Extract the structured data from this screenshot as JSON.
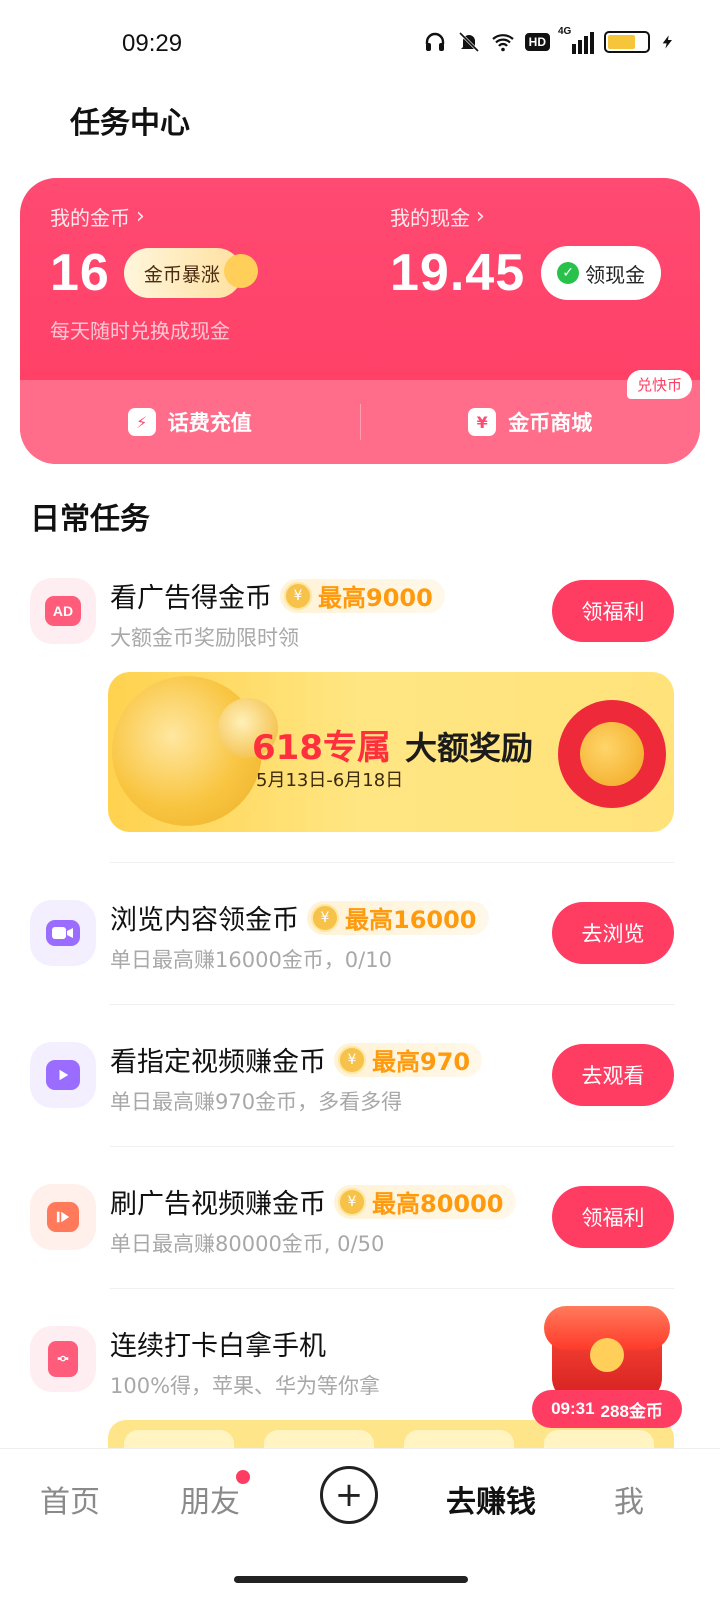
{
  "status_bar": {
    "time": "09:29",
    "network_label": "HD",
    "cell_label": "4G",
    "icons": [
      "headphones-icon",
      "mute-icon",
      "wifi-icon",
      "hd-icon",
      "signal-icon",
      "battery-icon",
      "charging-icon"
    ],
    "battery_level": 0.7
  },
  "header": {
    "title": "任务中心"
  },
  "wallet": {
    "coins_label": "我的金币",
    "coins_value": "16",
    "boom_label": "金币暴涨",
    "coins_sub": "每天随时兑换成现金",
    "cash_label": "我的现金",
    "cash_value": "19.45",
    "withdraw_label": "领现金",
    "recharge_label": "话费充值",
    "mall_label": "金币商城",
    "mall_badge": "兑快币",
    "accent": "#ff3d63"
  },
  "daily": {
    "title": "日常任务",
    "tasks": [
      {
        "title": "看广告得金币",
        "reward": "最高9000",
        "sub": "大额金币奖励限时领",
        "button": "领福利",
        "icon": "ad-icon",
        "icon_text": "AD"
      },
      {
        "title": "浏览内容领金币",
        "reward": "最高16000",
        "sub": "单日最高赚16000金币，0/10",
        "button": "去浏览",
        "icon": "video-camera-icon"
      },
      {
        "title": "看指定视频赚金币",
        "reward": "最高970",
        "sub": "单日最高赚970金币，多看多得",
        "button": "去观看",
        "icon": "play-icon"
      },
      {
        "title": "刷广告视频赚金币",
        "reward": "最高80000",
        "sub": "单日最高赚80000金币, 0/50",
        "button": "领福利",
        "icon": "video-play-icon"
      },
      {
        "title": "连续打卡白拿手机",
        "sub": "100%得，苹果、华为等你拿",
        "icon": "phone-gift-icon"
      }
    ]
  },
  "promo": {
    "title_red": "618专属",
    "title_black": "大额奖励",
    "date": "5月13日-6月18日"
  },
  "float_widget": {
    "timer": "09:31",
    "coins": "288金币"
  },
  "nav": {
    "items": [
      "首页",
      "朋友",
      "去赚钱",
      "我"
    ],
    "add_symbol": "+",
    "active": "去赚钱"
  }
}
